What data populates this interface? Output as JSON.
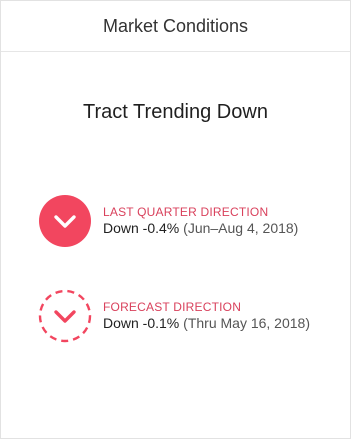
{
  "header": {
    "title": "Market Conditions"
  },
  "headline": "Tract Trending Down",
  "colors": {
    "accent": "#f2465f",
    "label": "#d9415c"
  },
  "last_quarter": {
    "label": "LAST QUARTER DIRECTION",
    "direction": "Down -0.4%",
    "detail": "(Jun–Aug 4, 2018)",
    "icon": "chevron-down-icon"
  },
  "forecast": {
    "label": "FORECAST DIRECTION",
    "direction": "Down -0.1%",
    "detail": "(Thru May 16, 2018)",
    "icon": "chevron-down-icon"
  }
}
